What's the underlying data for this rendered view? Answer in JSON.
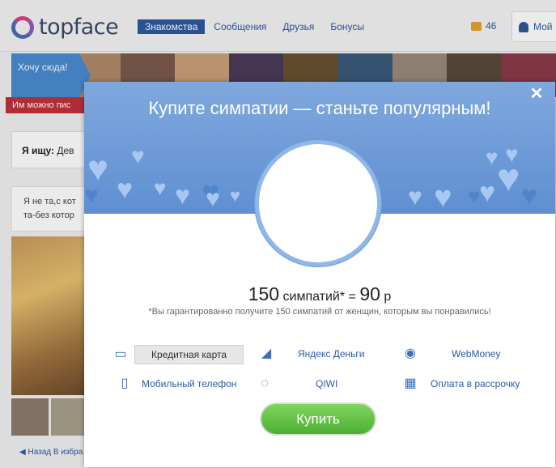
{
  "header": {
    "logo_text": "topface",
    "nav": [
      "Знакомства",
      "Сообщения",
      "Друзья",
      "Бонусы"
    ],
    "coins": "46",
    "user_label": "Мой"
  },
  "promo": {
    "text": "Хочу сюда!",
    "red_bar": "Им можно пис"
  },
  "search": {
    "label": "Я ищу:",
    "value": "Дев"
  },
  "description": "Я не та,с кот та-без котор",
  "back_link": "◀ Назад   В избра",
  "modal": {
    "title": "Купите симпатии — станьте популярным!",
    "close_symbol": "✕",
    "amount": "150",
    "unit": "симпатий*",
    "equals": "=",
    "price": "90",
    "currency": "р",
    "note": "*Вы гарантированно получите 150 симпатий от женщин, которым вы понравились!",
    "payment_methods": [
      {
        "label": "Кредитная карта",
        "icon": "credit-card-icon",
        "selected": true
      },
      {
        "label": "Яндекс Деньги",
        "icon": "yandex-money-icon",
        "selected": false
      },
      {
        "label": "WebMoney",
        "icon": "webmoney-icon",
        "selected": false
      },
      {
        "label": "Мобильный телефон",
        "icon": "mobile-phone-icon",
        "selected": false
      },
      {
        "label": "QIWI",
        "icon": "qiwi-icon",
        "selected": false
      },
      {
        "label": "Оплата в рассрочку",
        "icon": "calendar-icon",
        "selected": false
      }
    ],
    "buy_label": "Купить"
  },
  "colors": {
    "accent": "#2c5aa0",
    "header_blue": "#6f9bd8",
    "buy_green": "#5cc240"
  }
}
